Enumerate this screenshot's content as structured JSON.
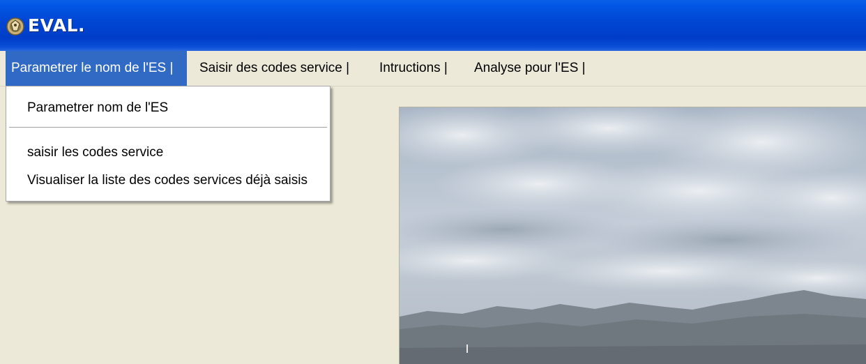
{
  "window": {
    "title": "EVAL.",
    "icon": "app-emblem-icon"
  },
  "menubar": {
    "items": [
      {
        "label": "Parametrer le nom de l'ES  |",
        "active": true
      },
      {
        "label": "Saisir des codes service  |"
      },
      {
        "label": "Intructions   |"
      },
      {
        "label": "Analyse pour l'ES       |"
      },
      {
        "label": ""
      }
    ]
  },
  "dropdown": {
    "items": [
      {
        "label": "Parametrer nom de l'ES"
      },
      {
        "label": "saisir les codes service"
      },
      {
        "label": "Visualiser la liste des codes services déjà saisis"
      }
    ]
  },
  "colors": {
    "titlebar": "#0047d4",
    "menu_highlight": "#316ac5",
    "window_bg": "#ece9d8"
  }
}
